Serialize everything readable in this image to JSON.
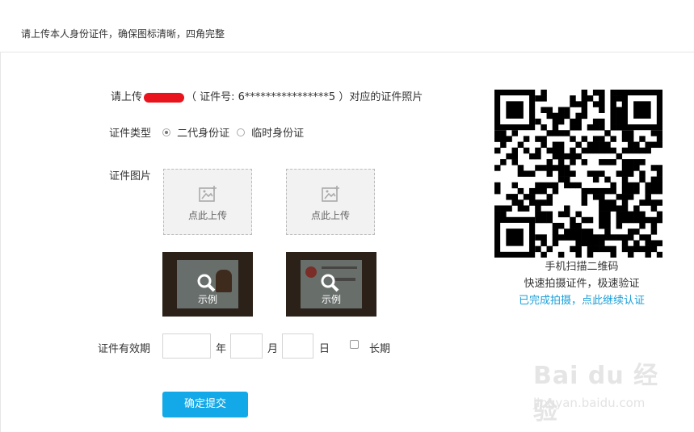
{
  "header": {
    "instruction": "请上传本人身份证件，确保图标清晰，四角完整"
  },
  "prompt": {
    "before": "请上传",
    "id_text": "（ 证件号: 6****************5 ）对应的证件照片"
  },
  "id_type": {
    "label": "证件类型",
    "options": [
      "二代身份证",
      "临时身份证"
    ],
    "selected": "二代身份证"
  },
  "images": {
    "label": "证件图片",
    "upload_front": "点此上传",
    "upload_back": "点此上传",
    "sample_front": "示例",
    "sample_back": "示例"
  },
  "validity": {
    "label": "证件有效期",
    "year_unit": "年",
    "month_unit": "月",
    "day_unit": "日",
    "long_term_label": "长期"
  },
  "submit_label": "确定提交",
  "qr": {
    "caption_1": "手机扫描二维码",
    "caption_2": "快速拍摄证件，极速验证",
    "link": "已完成拍摄，点此继续认证"
  },
  "watermark": {
    "main": "Bai du 经验",
    "sub": "jingyan.baidu.com"
  },
  "colors": {
    "accent": "#13a9e8",
    "link": "#1a9fd9",
    "redaction": "#e8131d"
  }
}
